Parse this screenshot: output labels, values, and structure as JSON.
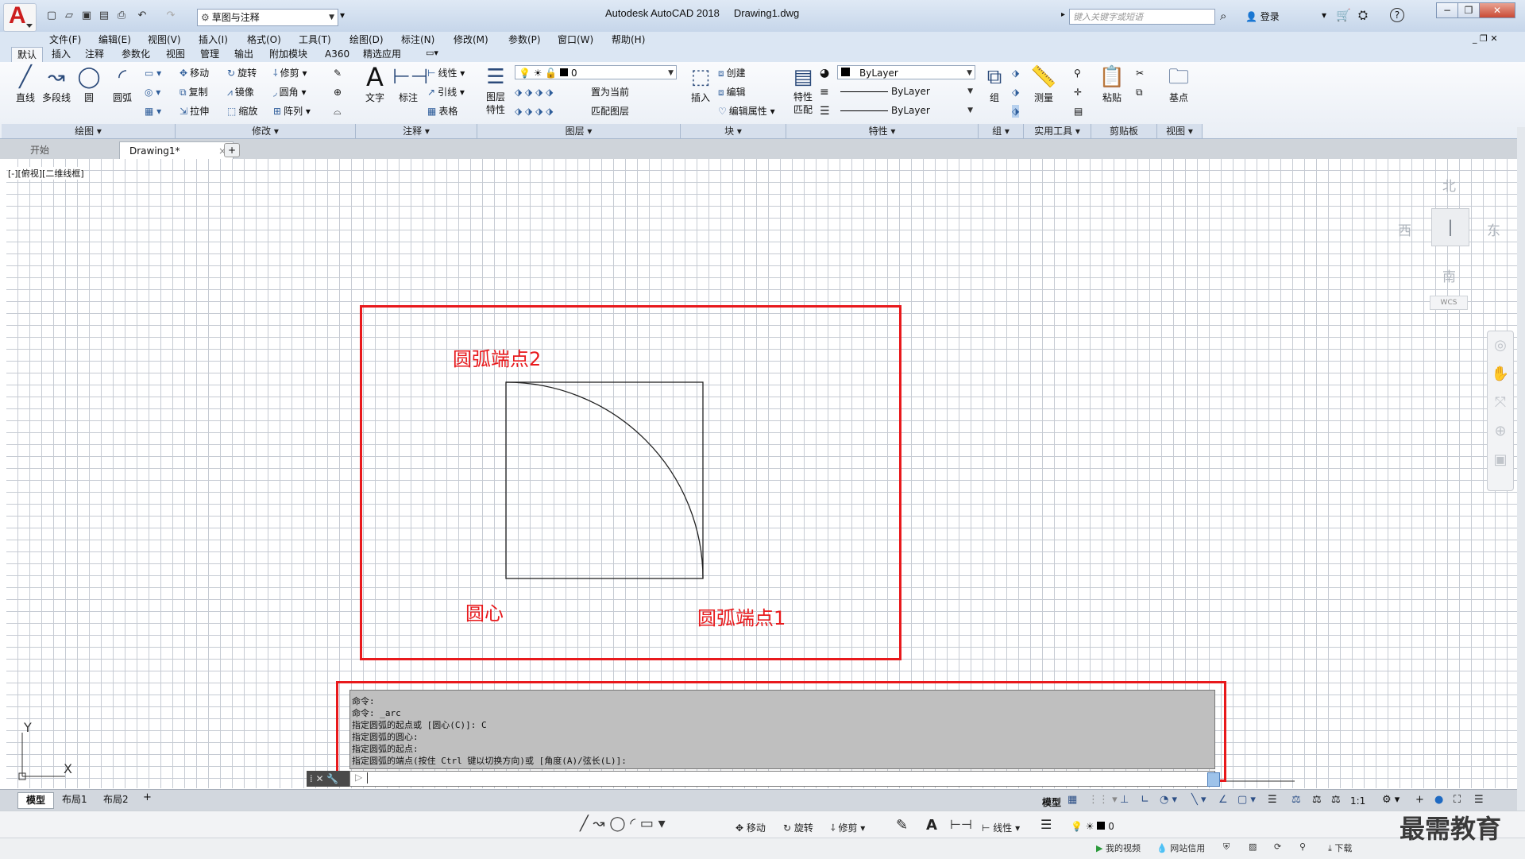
{
  "title_bar": {
    "app_title": "Autodesk AutoCAD 2018",
    "file_name": "Drawing1.dwg",
    "workspace": "草图与注释",
    "search_placeholder": "键入关键字或短语",
    "login_label": "登录",
    "help_label": "?"
  },
  "menu": [
    "文件(F)",
    "编辑(E)",
    "视图(V)",
    "插入(I)",
    "格式(O)",
    "工具(T)",
    "绘图(D)",
    "标注(N)",
    "修改(M)",
    "参数(P)",
    "窗口(W)",
    "帮助(H)"
  ],
  "ribbon_tabs": [
    "默认",
    "插入",
    "注释",
    "参数化",
    "视图",
    "管理",
    "输出",
    "附加模块",
    "A360",
    "精选应用"
  ],
  "ribbon": {
    "draw": {
      "panel": "绘图",
      "line": "直线",
      "polyline": "多段线",
      "circle": "圆",
      "arc": "圆弧"
    },
    "modify": {
      "panel": "修改",
      "move": "移动",
      "rotate": "旋转",
      "trim": "修剪",
      "copy": "复制",
      "mirror": "镜像",
      "fillet": "圆角",
      "stretch": "拉伸",
      "scale": "缩放",
      "array": "阵列"
    },
    "annotation": {
      "panel": "注释",
      "text": "文字",
      "dimension": "标注",
      "linear": "线性",
      "leader": "引线",
      "table": "表格"
    },
    "layers": {
      "panel": "图层",
      "layer_props": "图层特性",
      "current_layer": "0",
      "make_current": "置为当前",
      "match_layer": "匹配图层"
    },
    "block": {
      "panel": "块",
      "insert": "插入",
      "create": "创建",
      "edit": "编辑",
      "edit_attr": "编辑属性"
    },
    "properties": {
      "panel": "特性",
      "match": "特性匹配",
      "color": "ByLayer",
      "linetype": "ByLayer",
      "lineweight": "ByLayer"
    },
    "groups": {
      "panel": "组",
      "group": "组"
    },
    "utilities": {
      "panel": "实用工具",
      "measure": "测量"
    },
    "clipboard": {
      "panel": "剪贴板",
      "paste": "粘贴"
    },
    "view": {
      "panel": "视图",
      "base": "基点"
    }
  },
  "file_tabs": {
    "start": "开始",
    "drawing": "Drawing1*"
  },
  "viewport_label": "[-][俯视][二维线框]",
  "viewcube": {
    "north": "北",
    "south": "南",
    "east": "东",
    "west": "西",
    "wcs": "WCS"
  },
  "annotations": {
    "arc_end2": "圆弧端点2",
    "center": "圆心",
    "arc_end1": "圆弧端点1"
  },
  "command_history": [
    "命令:",
    "命令: _arc",
    "指定圆弧的起点或 [圆心(C)]: C",
    "指定圆弧的圆心:",
    "指定圆弧的起点:",
    "指定圆弧的端点(按住 Ctrl 键以切换方向)或 [角度(A)/弦长(L)]:"
  ],
  "layout_tabs": [
    "模型",
    "布局1",
    "布局2"
  ],
  "status": {
    "model": "模型",
    "scale": "1:1"
  },
  "taskbar_tools": {
    "move": "移动",
    "rotate": "旋转",
    "trim": "修剪",
    "linear": "线性",
    "layer": "0"
  },
  "bottom_bar": {
    "my_video": "我的视频",
    "net_credit": "网站信用",
    "download": "下载"
  },
  "watermark": "最需教育",
  "colors": {
    "annotation_red": "#e8191c",
    "grid": "#c6cbd3",
    "accent": "#2c4f86"
  }
}
